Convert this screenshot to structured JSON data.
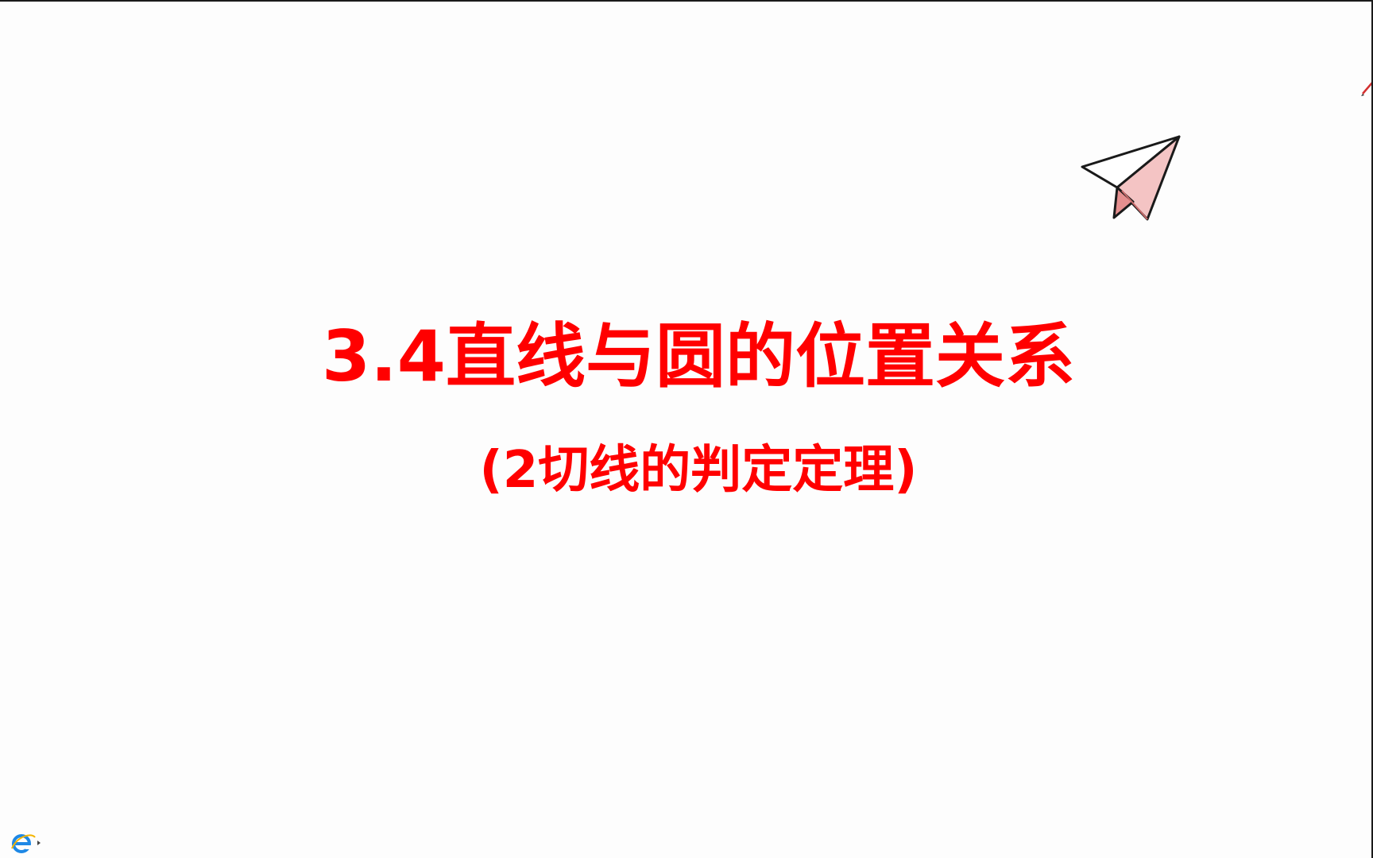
{
  "slide": {
    "title": "3.4直线与圆的位置关系",
    "subtitle": "(2切线的判定定理)"
  },
  "decorations": {
    "plane_icon": "paper-plane-icon",
    "pen_icon": "pen-cursor-icon"
  },
  "taskbar": {
    "browser_icon": "internet-explorer-icon"
  },
  "colors": {
    "title": "#ff0000",
    "background": "#fdfdfd",
    "plane_fill": "#f4c4c4",
    "plane_stroke": "#1a1a1a",
    "ie_blue": "#1e88e5"
  }
}
